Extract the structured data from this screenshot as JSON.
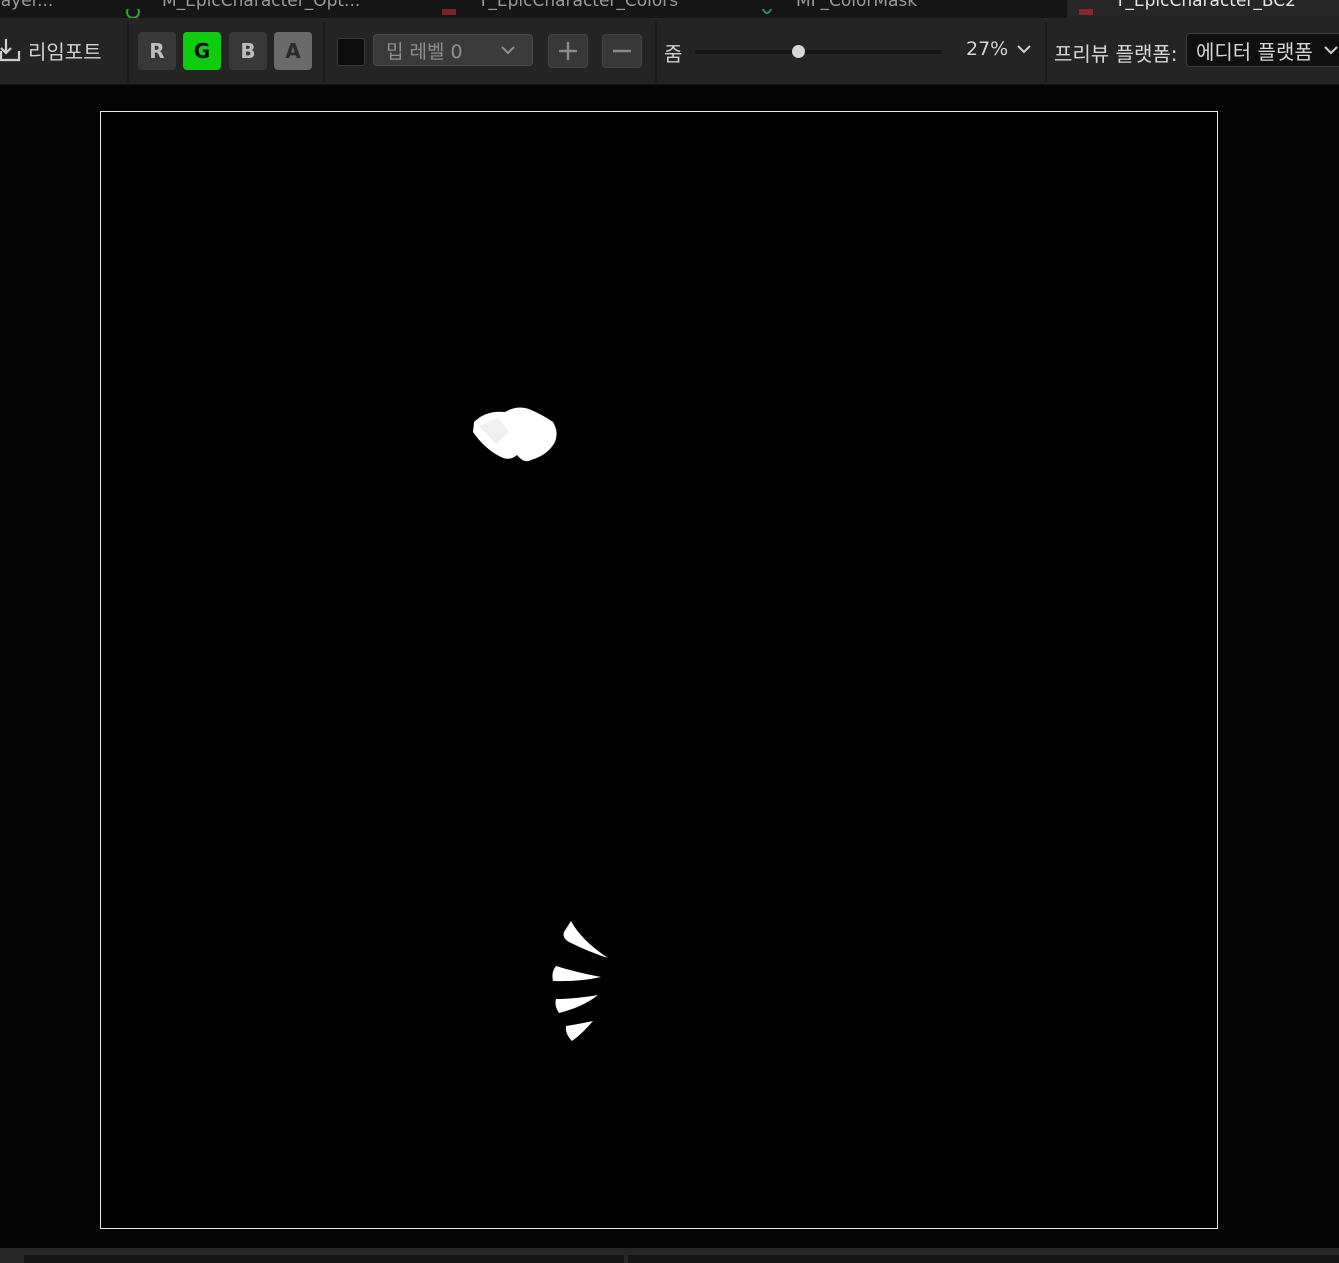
{
  "tabs": [
    {
      "label": "layer...",
      "icon": "material-instance-icon"
    },
    {
      "label": "M_EpicCharacter_Opt...",
      "icon": "material-icon"
    },
    {
      "label": "T_EpicCharacter_Colors",
      "icon": "texture-icon"
    },
    {
      "label": "MF_ColorMask",
      "icon": "material-function-icon"
    },
    {
      "label": "T_EpicCharacter_BC2",
      "icon": "texture-icon",
      "active": true
    }
  ],
  "toolbar": {
    "reimport_label": "리임포트",
    "channels": [
      "R",
      "G",
      "B",
      "A"
    ],
    "active_channel": "G",
    "mip_level": "밉 레벨 0",
    "zoom_label": "줌",
    "zoom_value": "27%",
    "zoom_slider_fraction": 0.42,
    "preview_platform_label": "프리뷰 플랫폼:",
    "preview_platform_value": "에디터 플랫폼"
  },
  "colors": {
    "active_channel": "#0ecc0e",
    "toolbar_bg": "#242424",
    "texture_bg": "#000000",
    "mask_white": "#ffffff"
  }
}
